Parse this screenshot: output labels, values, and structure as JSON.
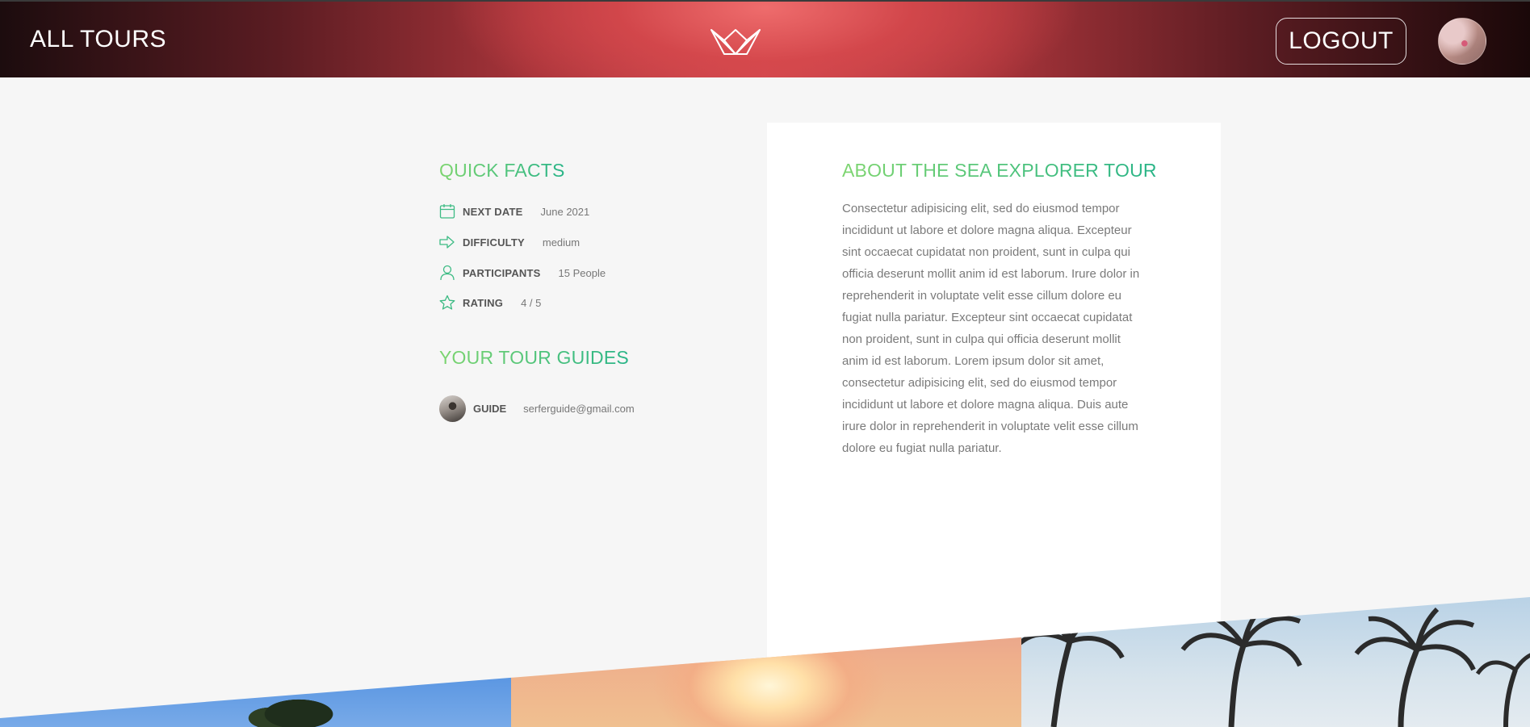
{
  "header": {
    "nav_label": "ALL TOURS",
    "logout_label": "LOGOUT"
  },
  "quick_facts": {
    "heading": "QUICK FACTS",
    "items": [
      {
        "icon": "calendar-icon",
        "label": "NEXT DATE",
        "value": "June 2021"
      },
      {
        "icon": "trending-arrow-icon",
        "label": "DIFFICULTY",
        "value": "medium"
      },
      {
        "icon": "user-icon",
        "label": "PARTICIPANTS",
        "value": "15 People"
      },
      {
        "icon": "star-icon",
        "label": "RATING",
        "value": "4 / 5"
      }
    ]
  },
  "guides": {
    "heading": "YOUR TOUR GUIDES",
    "items": [
      {
        "role": "GUIDE",
        "email": "serferguide@gmail.com"
      }
    ]
  },
  "about": {
    "heading": "ABOUT THE SEA EXPLORER TOUR",
    "text": "Consectetur adipisicing elit, sed do eiusmod tempor incididunt ut labore et dolore magna aliqua. Excepteur sint occaecat cupidatat non proident, sunt in culpa qui officia deserunt mollit anim id est laborum. Irure dolor in reprehenderit in voluptate velit esse cillum dolore eu fugiat nulla pariatur. Excepteur sint occaecat cupidatat non proident, sunt in culpa qui officia deserunt mollit anim id est laborum. Lorem ipsum dolor sit amet, consectetur adipisicing elit, sed do eiusmod tempor incididunt ut labore et dolore magna aliqua. Duis aute irure dolor in reprehenderit in voluptate velit esse cillum dolore eu fugiat nulla pariatur."
  },
  "colors": {
    "accent_start": "#7dd56f",
    "accent_end": "#28b487",
    "header_red": "#d24a50"
  }
}
